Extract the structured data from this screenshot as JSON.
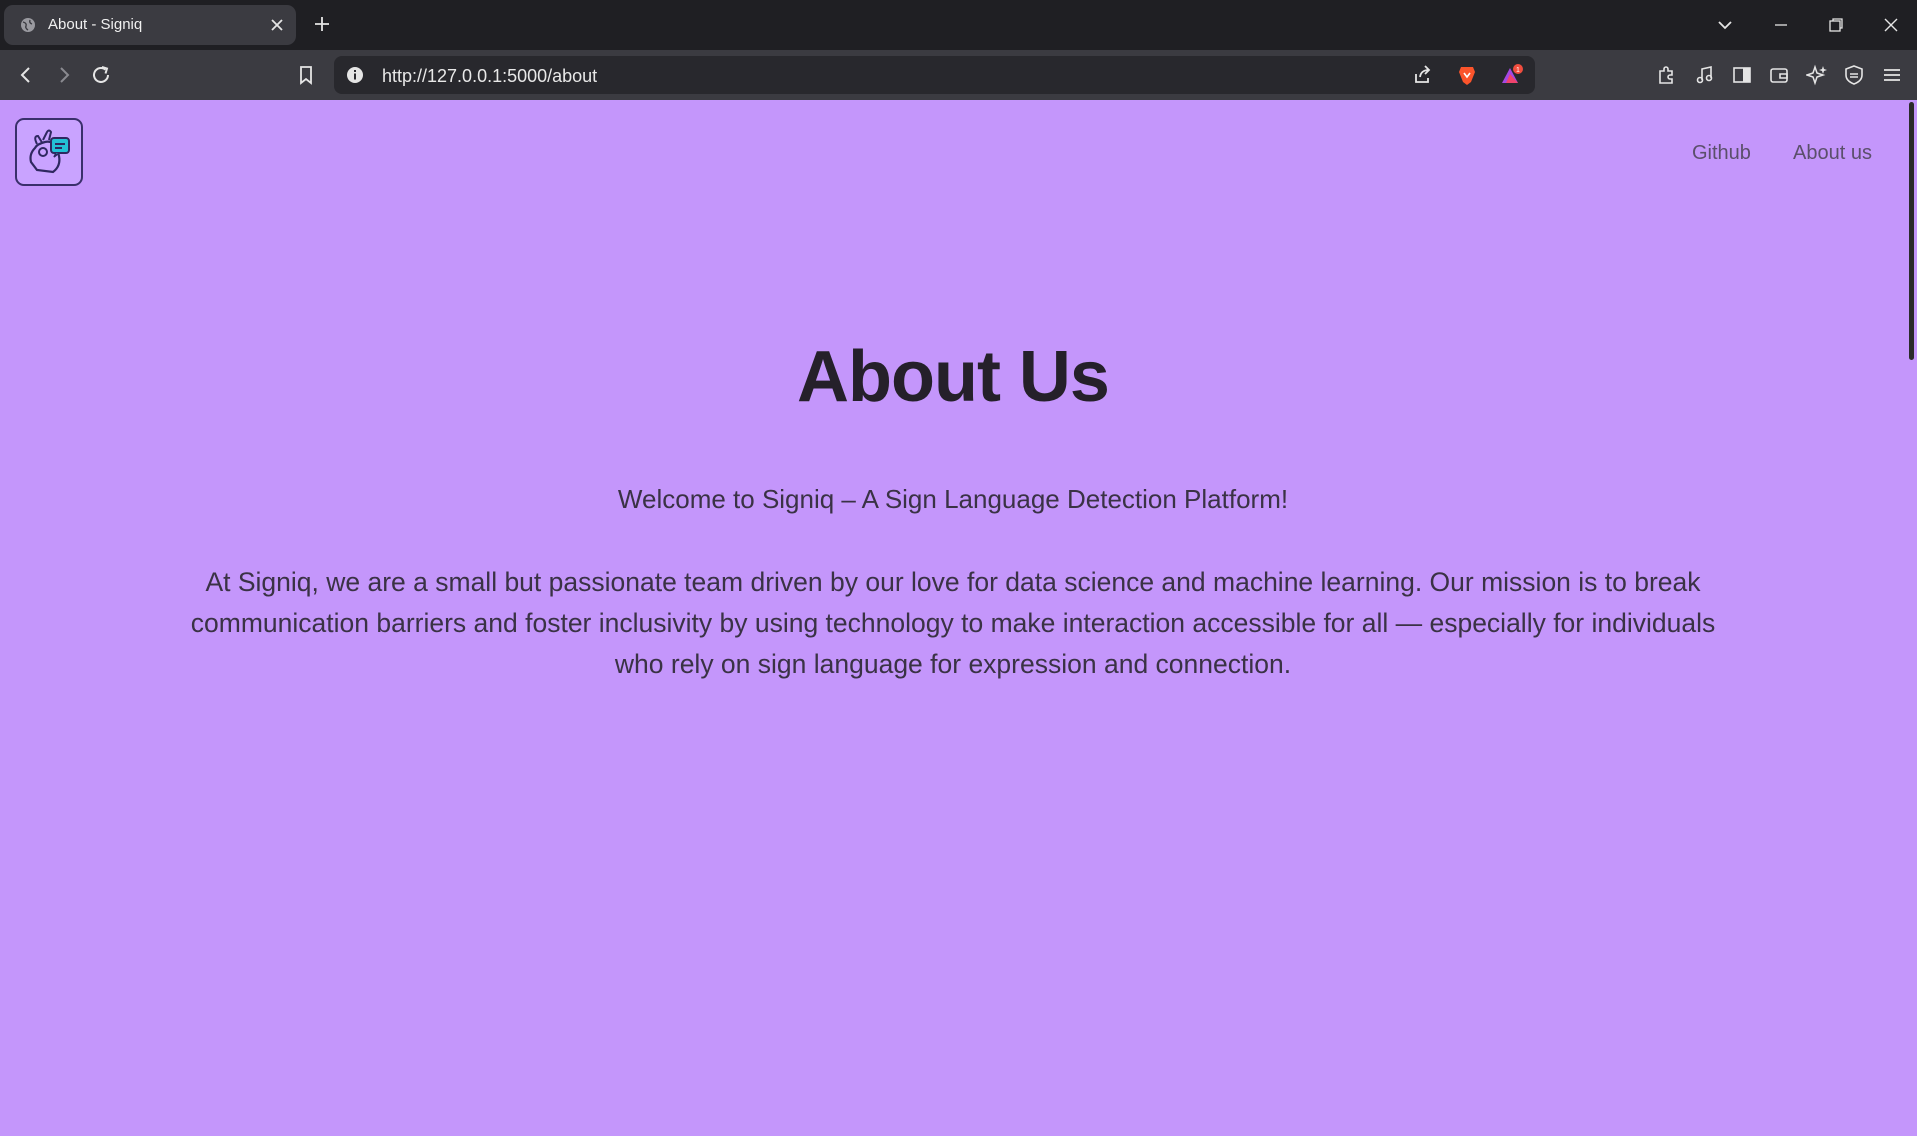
{
  "browser": {
    "tab_title": "About - Signiq",
    "url": "http://127.0.0.1:5000/about",
    "notification_count": "1"
  },
  "nav": {
    "links": [
      "Github",
      "About us"
    ]
  },
  "main": {
    "title": "About Us",
    "subtitle": "Welcome to Signiq – A Sign Language Detection Platform!",
    "paragraph": "At Signiq, we are a small but passionate team driven by our love for data science and machine learning. Our mission is to break communication barriers and foster inclusivity by using technology to make interaction accessible for all — especially for individuals who rely on sign language for expression and connection."
  },
  "colors": {
    "page_background": "#c496fb",
    "heading_text": "#25202a",
    "body_text": "#3a3245",
    "nav_text": "#5b4f6b",
    "logo_accent": "#23c1d6"
  }
}
